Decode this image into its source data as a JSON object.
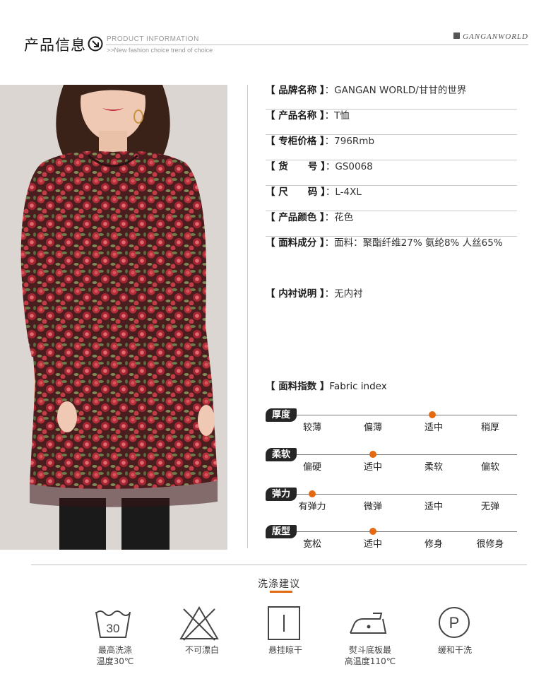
{
  "header": {
    "title": "产品信息",
    "en_title": "PRODUCT INFORMATION",
    "en_subtitle": ">>New fashion choice  trend of choice",
    "brand": "GANGANWORLD"
  },
  "info": [
    {
      "key": "【 品牌名称 】",
      "sep": "：",
      "value": "GANGAN WORLD/甘甘的世界"
    },
    {
      "key": "【 产品名称 】",
      "sep": "：",
      "value": "T恤"
    },
    {
      "key": "【 专柜价格 】",
      "sep": "：",
      "value": "796Rmb"
    },
    {
      "key": "【 货      号 】",
      "sep": "：",
      "value": "GS0068"
    },
    {
      "key": "【 尺      码 】",
      "sep": "：",
      "value": "L-4XL"
    },
    {
      "key": "【 产品颜色 】",
      "sep": "：",
      "value": "花色"
    },
    {
      "key": "【 面料成分 】",
      "sep": "：",
      "value": "面料：聚酯纤维27%  氨纶8%  人丝65%"
    },
    {
      "key": "【 内衬说明 】",
      "sep": "：",
      "value": "无内衬"
    }
  ],
  "fabric": {
    "title_key": "【 面料指数 】",
    "title_value": "Fabric index",
    "indices": [
      {
        "name": "厚度",
        "options": [
          "较薄",
          "偏薄",
          "适中",
          "稍厚"
        ],
        "selected": 2
      },
      {
        "name": "柔软",
        "options": [
          "偏硬",
          "适中",
          "柔软",
          "偏软"
        ],
        "selected": 1
      },
      {
        "name": "弹力",
        "options": [
          "有弹力",
          "微弹",
          "适中",
          "无弹"
        ],
        "selected": 0
      },
      {
        "name": "版型",
        "options": [
          "宽松",
          "适中",
          "修身",
          "很修身"
        ],
        "selected": 1
      }
    ]
  },
  "wash": {
    "title": "洗涤建议",
    "accent": "#e46a11",
    "items": [
      {
        "icon": "wash-30-icon",
        "symbol": "30",
        "line1": "最高洗涤",
        "line2": "温度30℃"
      },
      {
        "icon": "no-bleach-icon",
        "line1": "不可漂白",
        "line2": ""
      },
      {
        "icon": "hang-dry-icon",
        "line1": "悬挂晾干",
        "line2": ""
      },
      {
        "icon": "iron-icon",
        "line1": "熨斗底板最",
        "line2": "高温度110℃"
      },
      {
        "icon": "dry-clean-icon",
        "symbol": "P",
        "line1": "缓和干洗",
        "line2": ""
      }
    ]
  }
}
